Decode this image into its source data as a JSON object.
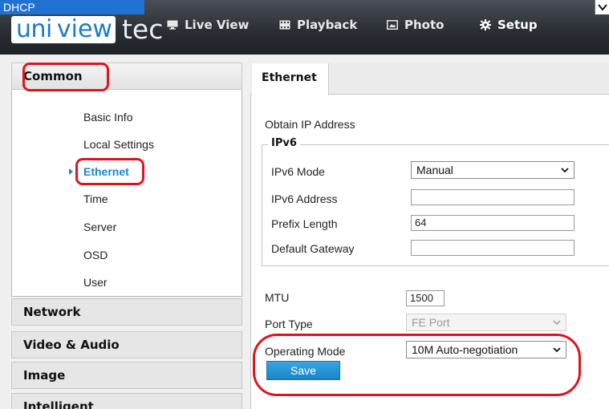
{
  "brand": {
    "uni": "uni",
    "view": "view",
    "tec": "tec"
  },
  "nav": {
    "live_view": "Live View",
    "playback": "Playback",
    "photo": "Photo",
    "setup": "Setup"
  },
  "sidebar": {
    "categories": {
      "common": "Common",
      "network": "Network",
      "video_audio": "Video & Audio",
      "image": "Image",
      "intelligent": "Intelligent"
    },
    "common_items": [
      "Basic Info",
      "Local Settings",
      "Ethernet",
      "Time",
      "Server",
      "OSD",
      "User"
    ],
    "active_item": "Ethernet"
  },
  "tabs": {
    "ethernet": "Ethernet"
  },
  "form": {
    "obtain_ip_label": "Obtain IP Address",
    "obtain_ip_value": "DHCP",
    "ipv6_legend": "IPv6",
    "ipv6_mode_label": "IPv6 Mode",
    "ipv6_mode_value": "Manual",
    "ipv6_address_label": "IPv6 Address",
    "ipv6_address_value": "",
    "prefix_length_label": "Prefix Length",
    "prefix_length_value": "64",
    "default_gateway_label": "Default Gateway",
    "default_gateway_value": "",
    "mtu_label": "MTU",
    "mtu_value": "1500",
    "port_type_label": "Port Type",
    "port_type_value": "FE Port",
    "operating_mode_label": "Operating Mode",
    "operating_mode_value": "10M Auto-negotiation",
    "save_label": "Save"
  },
  "colors": {
    "accent": "#1b86c9",
    "annotation": "#e0141e",
    "selection": "#1f72d2"
  }
}
